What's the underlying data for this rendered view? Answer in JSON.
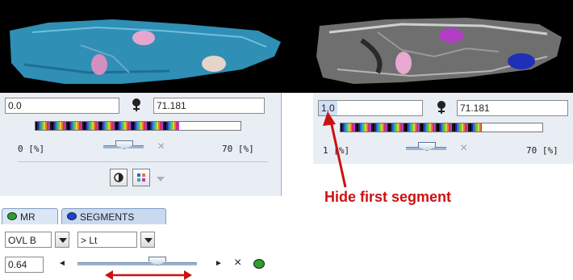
{
  "left_panel": {
    "value_min": "0.0",
    "value_max": "71.181",
    "range_left": "0 [%]",
    "range_right": "70 [%]",
    "close_glyph": "×",
    "tabs": [
      {
        "label": "MR",
        "color": "#2ca02c"
      },
      {
        "label": "SEGMENTS",
        "color": "#1f3fd6"
      }
    ],
    "segment_select": "OVL B",
    "operator_select": "> Lt",
    "threshold_value": "0.64",
    "left_glyph": "◄",
    "right_glyph": "►",
    "remove_glyph": "×"
  },
  "right_panel": {
    "value_min": "1.0",
    "value_max": "71.181",
    "range_left": "1 [%]",
    "range_right": "70 [%]",
    "close_glyph": "×"
  },
  "annotation": {
    "text": "Hide first segment",
    "color": "#cc1111"
  },
  "icons": {
    "left_thermo": "thermometer-icon",
    "right_thermo": "thermometer-icon",
    "contrast": "contrast-icon",
    "overlay": "overlay-icon",
    "more": "chevron-down-icon",
    "status": "green-dot-icon"
  }
}
